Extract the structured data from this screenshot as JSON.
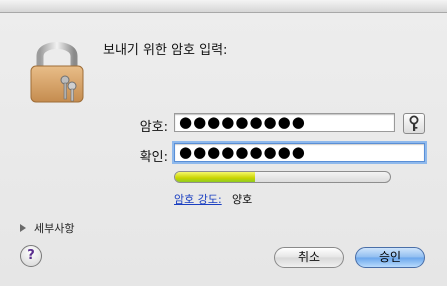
{
  "dialog": {
    "prompt": "보내기 위한 암호 입력:",
    "password": {
      "label": "암호:",
      "value": "●●●●●●●●●"
    },
    "verify": {
      "label": "확인:",
      "value": "●●●●●●●●●"
    },
    "strength": {
      "link": "암호 강도:",
      "value": "양호",
      "level": 0.37
    },
    "details": {
      "label": "세부사항"
    },
    "buttons": {
      "help": "?",
      "cancel": "취소",
      "ok": "승인"
    }
  },
  "icons": {
    "lock": "padlock-keys-icon",
    "key": "key-icon",
    "disclosure": "disclosure-triangle-icon"
  },
  "colors": {
    "link": "#1a3fc1",
    "focus_ring": "#8fb9ec",
    "ok_button": "#6aa6ec"
  }
}
